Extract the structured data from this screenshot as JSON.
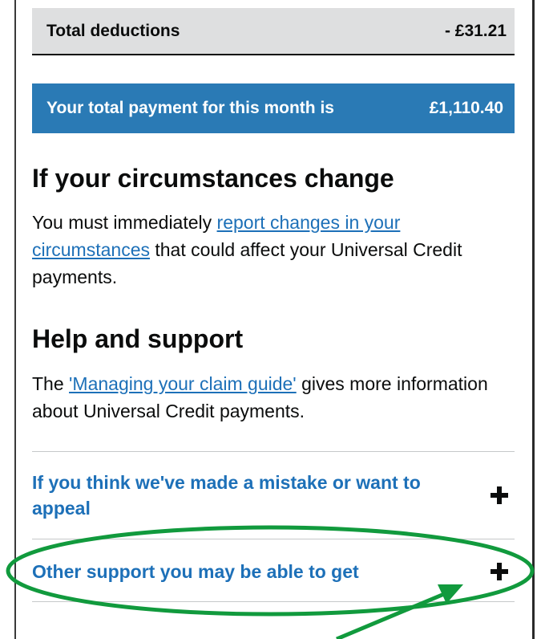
{
  "summary": {
    "deductions_label": "Total deductions",
    "deductions_value": "- £31.21",
    "payment_label": "Your total payment for this month is",
    "payment_value": "£1,110.40"
  },
  "circumstances": {
    "heading": "If your circumstances change",
    "text_before": "You must immediately ",
    "link_text": "report changes in your circumstances",
    "text_after": " that could affect your Universal Credit payments."
  },
  "help": {
    "heading": "Help and support",
    "text_before": "The ",
    "link_text": "'Managing your claim guide'",
    "text_after": " gives more information about Universal Credit payments."
  },
  "accordion": {
    "items": [
      {
        "title": "If you think we've made a mistake or want to appeal",
        "icon": "plus-icon"
      },
      {
        "title": "Other support you may be able to get",
        "icon": "plus-icon"
      }
    ]
  },
  "annotation": {
    "color": "#119a3d"
  }
}
